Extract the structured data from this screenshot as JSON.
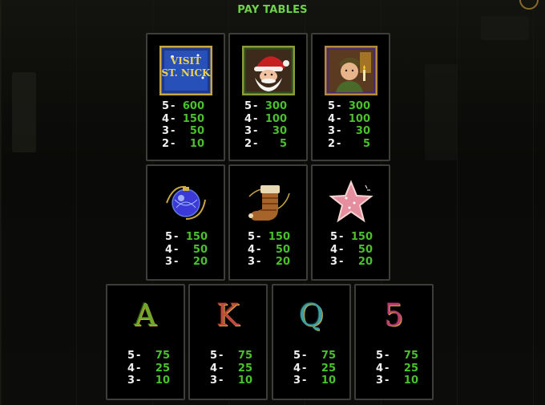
{
  "title": "PAY TABLES",
  "colors": {
    "accent_green": "#49c12b",
    "title_green": "#6fd24a",
    "card_border": "#3d3d3a"
  },
  "rows": [
    [
      {
        "symbol": "visit-st-nick-logo",
        "logo_text": "VISIT ST. NICK",
        "pays": [
          [
            "5",
            "600"
          ],
          [
            "4",
            "150"
          ],
          [
            "3",
            "50"
          ],
          [
            "2",
            "10"
          ]
        ]
      },
      {
        "symbol": "santa",
        "pays": [
          [
            "5",
            "300"
          ],
          [
            "4",
            "100"
          ],
          [
            "3",
            "30"
          ],
          [
            "2",
            "5"
          ]
        ]
      },
      {
        "symbol": "boy-with-candle",
        "pays": [
          [
            "5",
            "300"
          ],
          [
            "4",
            "100"
          ],
          [
            "3",
            "30"
          ],
          [
            "2",
            "5"
          ]
        ]
      }
    ],
    [
      {
        "symbol": "ornament",
        "pays": [
          [
            "5",
            "150"
          ],
          [
            "4",
            "50"
          ],
          [
            "3",
            "20"
          ]
        ]
      },
      {
        "symbol": "stocking",
        "pays": [
          [
            "5",
            "150"
          ],
          [
            "4",
            "50"
          ],
          [
            "3",
            "20"
          ]
        ]
      },
      {
        "symbol": "star-cookie",
        "pays": [
          [
            "5",
            "150"
          ],
          [
            "4",
            "50"
          ],
          [
            "3",
            "20"
          ]
        ]
      }
    ],
    [
      {
        "symbol": "letter-A",
        "glyph": "A",
        "pays": [
          [
            "5",
            "75"
          ],
          [
            "4",
            "25"
          ],
          [
            "3",
            "10"
          ]
        ]
      },
      {
        "symbol": "letter-K",
        "glyph": "K",
        "pays": [
          [
            "5",
            "75"
          ],
          [
            "4",
            "25"
          ],
          [
            "3",
            "10"
          ]
        ]
      },
      {
        "symbol": "letter-Q",
        "glyph": "Q",
        "pays": [
          [
            "5",
            "75"
          ],
          [
            "4",
            "25"
          ],
          [
            "3",
            "10"
          ]
        ]
      },
      {
        "symbol": "number-5",
        "glyph": "5",
        "pays": [
          [
            "5",
            "75"
          ],
          [
            "4",
            "25"
          ],
          [
            "3",
            "10"
          ]
        ]
      }
    ]
  ]
}
